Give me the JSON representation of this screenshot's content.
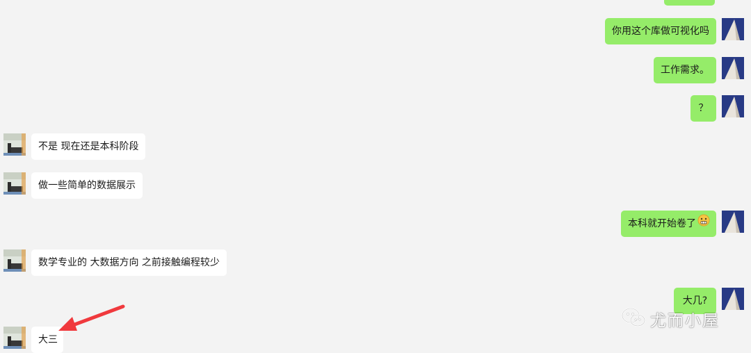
{
  "messages": [
    {
      "side": "me",
      "text": ""
    },
    {
      "side": "me",
      "text": "你用这个库做可视化吗"
    },
    {
      "side": "me",
      "text": "工作需求。"
    },
    {
      "side": "me",
      "text": "？"
    },
    {
      "side": "them",
      "text": "不是 现在还是本科阶段"
    },
    {
      "side": "them",
      "text": "做一些简单的数据展示"
    },
    {
      "side": "me",
      "text": "本科就开始卷了",
      "emoji": "grimace-emoji"
    },
    {
      "side": "them",
      "text": "数学专业的 大数据方向 之前接触编程较少"
    },
    {
      "side": "me",
      "text": "大几?"
    },
    {
      "side": "them",
      "text": "大三"
    }
  ],
  "watermark": {
    "text": "尤而小屋",
    "icon": "wechat-icon"
  },
  "annotation": {
    "icon": "red-arrow",
    "color": "#f0393d"
  },
  "colors": {
    "background": "#f3f3f3",
    "my_bubble": "#95ec69",
    "their_bubble": "#ffffff"
  }
}
